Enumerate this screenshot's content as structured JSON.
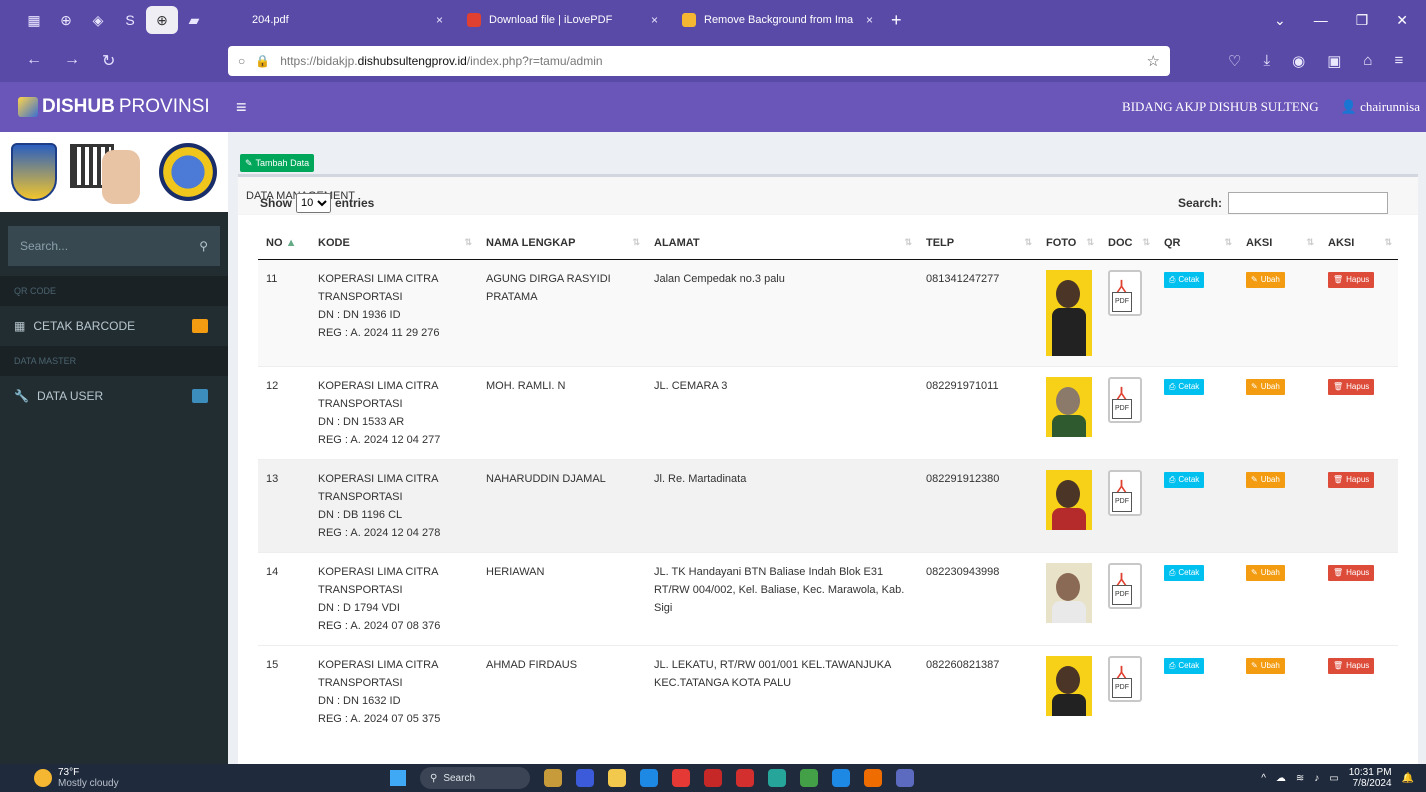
{
  "browser": {
    "tabs": [
      {
        "title": "204.pdf",
        "close": "×",
        "fav_color": "#e0402f"
      },
      {
        "title": "Download file | iLovePDF",
        "close": "×",
        "fav_color": "#e0402f"
      },
      {
        "title": "Remove Background from Ima",
        "close": "×",
        "fav_color": "#f5b731"
      }
    ],
    "new_tab": "+",
    "url_prefix": "https://bidakjp.",
    "url_host": "dishubsultengprov.id",
    "url_path": "/index.php?r=tamu/admin"
  },
  "header": {
    "brand_bold": "DISHUB",
    "brand_light": " PROVINSI",
    "menu_icon": "≡",
    "org": "BIDANG AKJP DISHUB SULTENG",
    "user": "chairunnisa"
  },
  "sidebar": {
    "search_placeholder": "Search...",
    "sections": [
      {
        "header": "QR CODE",
        "item": "CETAK BARCODE"
      },
      {
        "header": "DATA MASTER",
        "item": "DATA USER"
      }
    ]
  },
  "main": {
    "add_button": "Tambah Data",
    "box_title": "DATA MANAGEMENT",
    "show_label": "Show",
    "entries_value": "10",
    "entries_label": "entries",
    "search_label": "Search:"
  },
  "table": {
    "columns": [
      "NO",
      "KODE",
      "NAMA LENGKAP",
      "ALAMAT",
      "TELP",
      "FOTO",
      "DOC",
      "QR",
      "AKSI",
      "AKSI"
    ],
    "rows": [
      {
        "no": "11",
        "kode": [
          "KOPERASI LIMA CITRA",
          "TRANSPORTASI",
          "DN : DN 1936 ID",
          "REG : A. 2024 11 29 276"
        ],
        "nama": "AGUNG DIRGA RASYIDI PRATAMA",
        "alamat": "Jalan Cempedak no.3 palu",
        "telp": "081341247277"
      },
      {
        "no": "12",
        "kode": [
          "KOPERASI LIMA CITRA",
          "TRANSPORTASI",
          "DN : DN 1533 AR",
          "REG : A. 2024 12 04 277"
        ],
        "nama": "MOH. RAMLI. N",
        "alamat": "JL. CEMARA 3",
        "telp": "082291971011"
      },
      {
        "no": "13",
        "kode": [
          "KOPERASI LIMA CITRA",
          "TRANSPORTASI",
          "DN : DB 1196 CL",
          "REG : A. 2024 12 04 278"
        ],
        "nama": "NAHARUDDIN DJAMAL",
        "alamat": "Jl. Re. Martadinata",
        "telp": "082291912380"
      },
      {
        "no": "14",
        "kode": [
          "KOPERASI LIMA CITRA",
          "TRANSPORTASI",
          "DN : D 1794 VDI",
          "REG : A. 2024 07 08 376"
        ],
        "nama": "HERIAWAN",
        "alamat": "JL. TK Handayani BTN Baliase Indah Blok E31 RT/RW 004/002, Kel. Baliase, Kec. Marawola, Kab. Sigi",
        "telp": "082230943998"
      },
      {
        "no": "15",
        "kode": [
          "KOPERASI LIMA CITRA",
          "TRANSPORTASI",
          "DN : DN 1632 ID",
          "REG : A. 2024 07 05 375"
        ],
        "nama": "AHMAD FIRDAUS",
        "alamat": "JL. LEKATU, RT/RW 001/001 KEL.TAWANJUKA KEC.TATANGA KOTA PALU",
        "telp": "082260821387"
      }
    ],
    "pdf_label": "PDF",
    "cetak_label": "Cetak",
    "ubah_label": "Ubah",
    "hapus_label": "Hapus"
  },
  "taskbar": {
    "temp": "73°F",
    "weather": "Mostly cloudy",
    "search": "Search",
    "time": "10:31 PM",
    "date": "7/8/2024"
  },
  "colors": {
    "chrome": "#5a4aa8",
    "app_header": "#6a55b8",
    "sidebar": "#222d32",
    "add": "#00a65a",
    "cetak": "#00c0ef",
    "ubah": "#f39c12",
    "hapus": "#dd4b39"
  }
}
